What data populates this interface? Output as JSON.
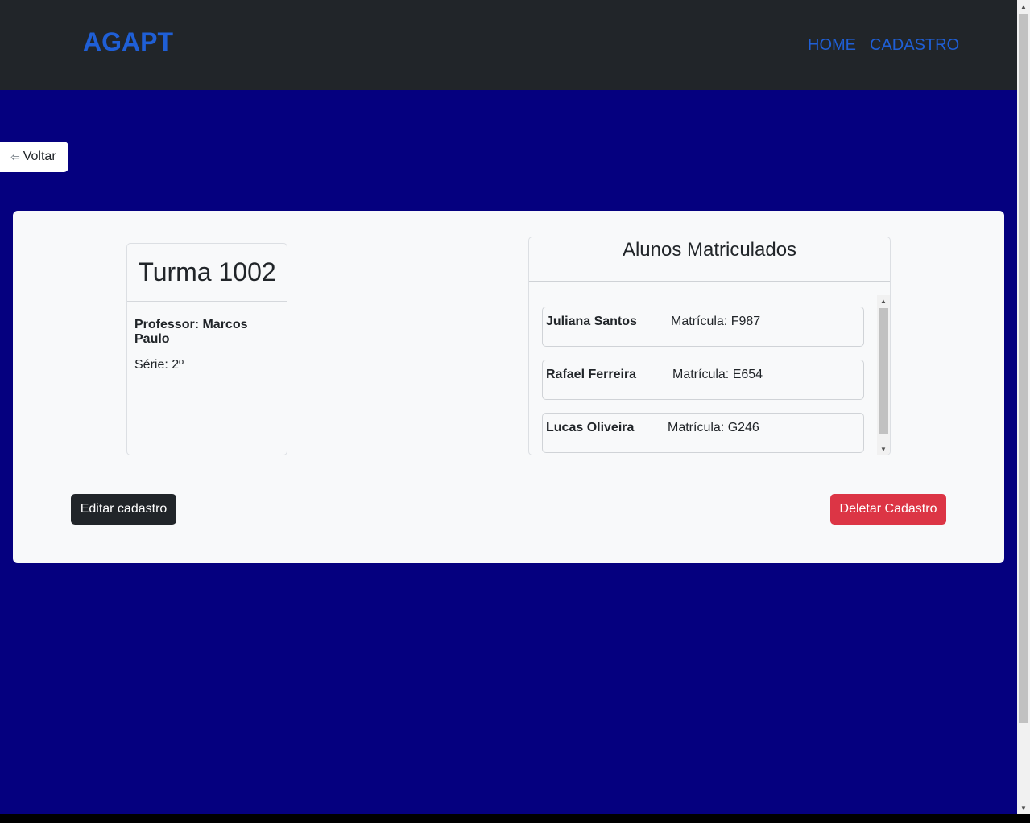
{
  "navbar": {
    "brand": "AGAPT",
    "links": [
      "HOME",
      "CADASTRO"
    ]
  },
  "back_button": {
    "icon": "left-arrow-icon",
    "arrow_glyph": "⇦",
    "label": "Voltar"
  },
  "turma": {
    "title": "Turma 1002",
    "professor": "Professor: Marcos Paulo",
    "serie": "Série: 2º"
  },
  "alunos": {
    "title": "Alunos Matriculados",
    "items": [
      {
        "nome": "Juliana Santos",
        "matricula": "Matrícula: F987"
      },
      {
        "nome": "Rafael Ferreira",
        "matricula": "Matrícula: E654"
      },
      {
        "nome": "Lucas Oliveira",
        "matricula": "Matrícula: G246"
      }
    ]
  },
  "actions": {
    "edit_label": "Editar cadastro",
    "delete_label": "Deletar Cadastro"
  },
  "colors": {
    "page_bg": "#05007f",
    "navbar_bg": "#212529",
    "link": "#1f5fd6",
    "danger": "#dc3545",
    "dark_button": "#212529"
  }
}
